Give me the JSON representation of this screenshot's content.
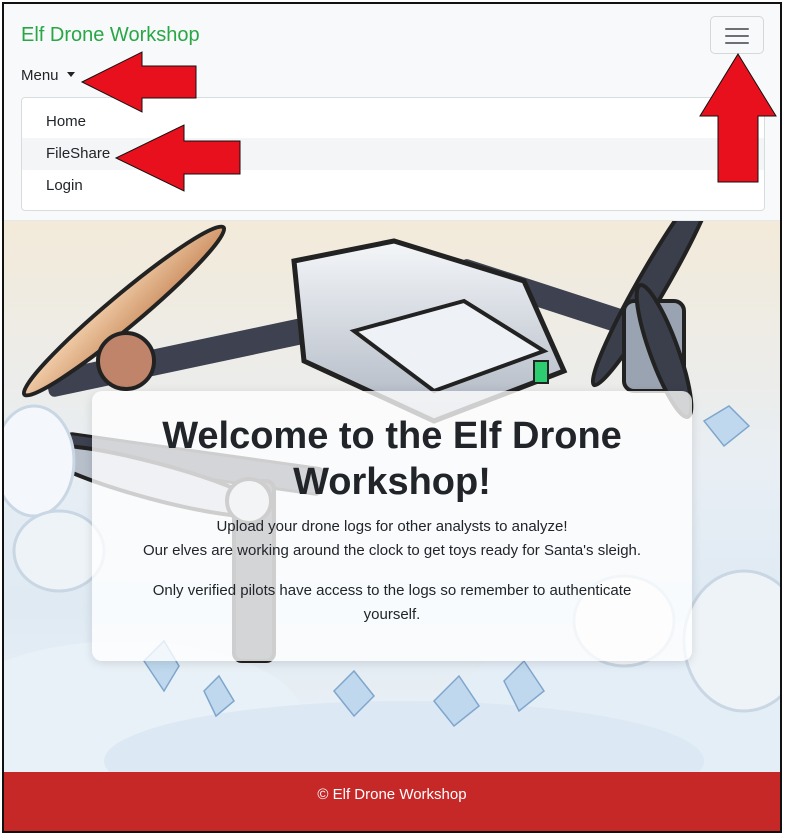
{
  "navbar": {
    "brand": "Elf Drone Workshop",
    "menu_label": "Menu",
    "toggler_icon": "hamburger-icon",
    "dropdown_items": [
      {
        "label": "Home"
      },
      {
        "label": "FileShare"
      },
      {
        "label": "Login"
      }
    ]
  },
  "hero": {
    "title": "Welcome to the Elf Drone Workshop!",
    "line1": "Upload your drone logs for other analysts to analyze!",
    "line2": "Our elves are working around the clock to get toys ready for Santa's sleigh.",
    "note": "Only verified pilots have access to the logs so remember to authenticate yourself."
  },
  "footer": {
    "text": "© Elf Drone Workshop"
  },
  "colors": {
    "brand": "#28a745",
    "footer_bg": "#c62828",
    "arrow": "#e8101c"
  }
}
